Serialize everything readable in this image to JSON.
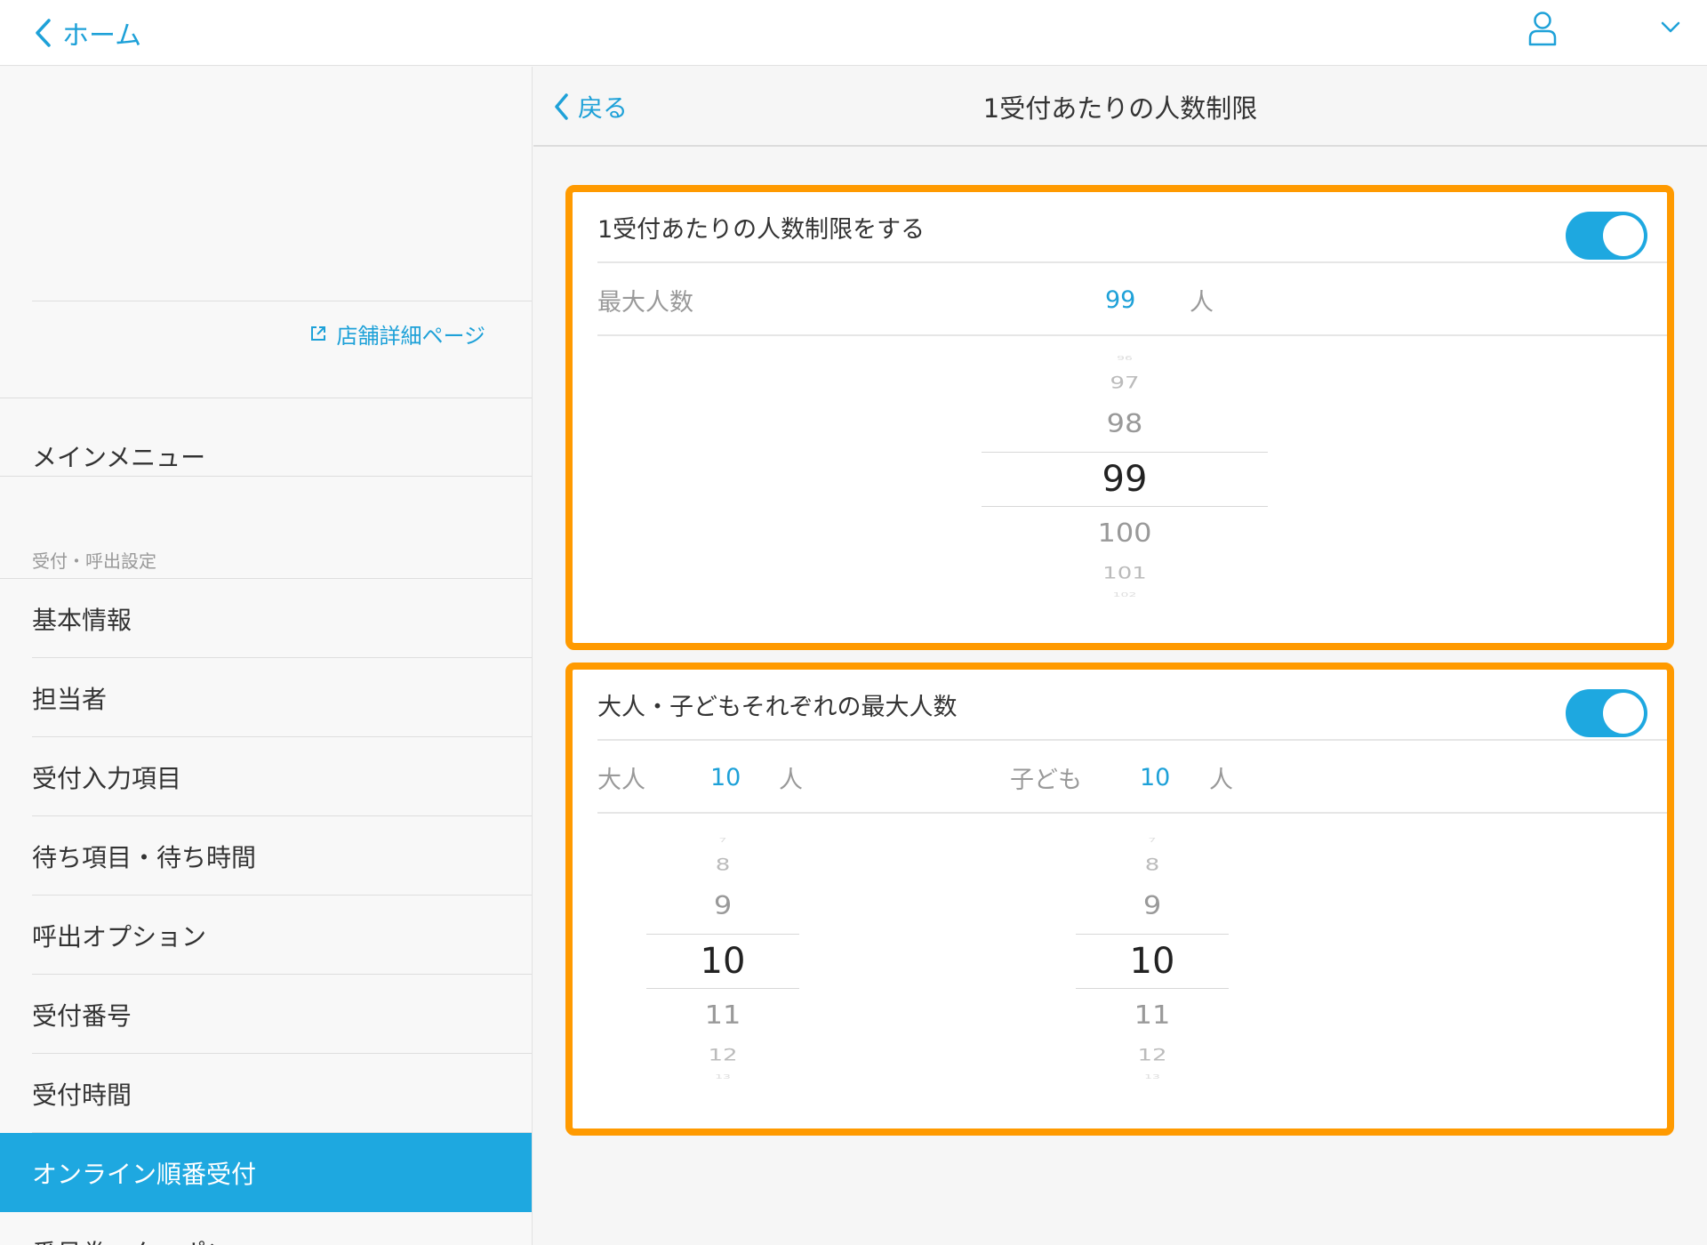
{
  "topbar": {
    "home_label": "ホーム",
    "icons": [
      "chevron-left-icon",
      "user-icon",
      "chevron-down-icon"
    ]
  },
  "sidebar": {
    "store_link": "店舗詳細ページ",
    "menu_title": "メインメニュー",
    "section_label": "受付・呼出設定",
    "items": [
      {
        "label": "基本情報"
      },
      {
        "label": "担当者"
      },
      {
        "label": "受付入力項目"
      },
      {
        "label": "待ち項目・待ち時間"
      },
      {
        "label": "呼出オプション"
      },
      {
        "label": "受付番号"
      },
      {
        "label": "受付時間"
      },
      {
        "label": "オンライン順番受付",
        "active": true
      },
      {
        "label": "番号券・クーポン"
      }
    ]
  },
  "header": {
    "back_label": "戻る",
    "title": "1受付あたりの人数制限"
  },
  "limit_card": {
    "toggle_label": "1受付あたりの人数制限をする",
    "toggle_on": true,
    "max_label": "最大人数",
    "max_value": "99",
    "unit": "人",
    "picker": [
      "96",
      "97",
      "98",
      "99",
      "100",
      "101",
      "102"
    ]
  },
  "split_card": {
    "toggle_label": "大人・子どもそれぞれの最大人数",
    "toggle_on": true,
    "adult_label": "大人",
    "adult_value": "10",
    "child_label": "子ども",
    "child_value": "10",
    "unit": "人",
    "adult_picker": [
      "7",
      "8",
      "9",
      "10",
      "11",
      "12",
      "13"
    ],
    "child_picker": [
      "7",
      "8",
      "9",
      "10",
      "11",
      "12",
      "13"
    ]
  },
  "colors": {
    "accent": "#1ea8e0",
    "link": "#1ea1d8",
    "highlight_border": "#ff9a00"
  }
}
